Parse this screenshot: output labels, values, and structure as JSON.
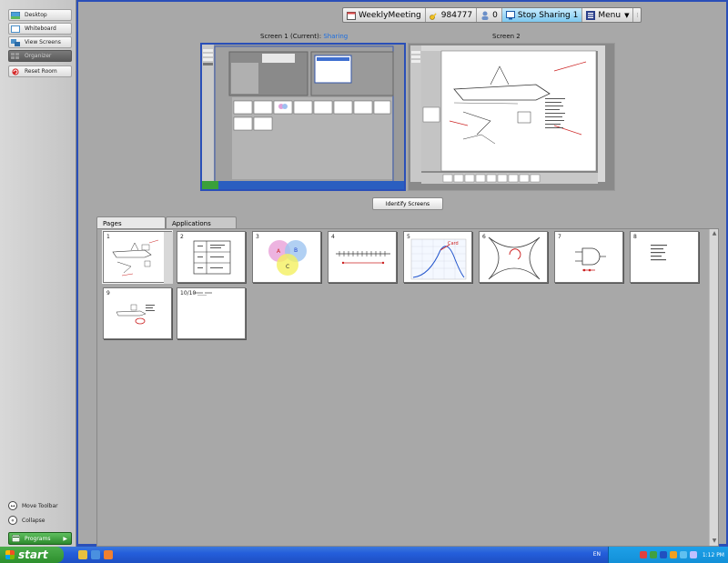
{
  "left_toolbar": {
    "items": [
      {
        "label": "Desktop",
        "active": false
      },
      {
        "label": "Whiteboard",
        "active": false
      },
      {
        "label": "View Screens",
        "active": false
      },
      {
        "label": "Organizer",
        "active": true
      },
      {
        "label": "Reset Room",
        "active": false
      }
    ],
    "move_label": "Move Toolbar",
    "collapse_label": "Collapse",
    "programs_label": "Programs"
  },
  "top_toolbar": {
    "meeting_name": "WeeklyMeeting",
    "meeting_id": "984777",
    "participant_count": "0",
    "share_label": "Stop Sharing 1",
    "menu_label": "Menu"
  },
  "screens": {
    "screen1_label": "Screen 1 (Current):",
    "screen1_status": "Sharing",
    "screen2_label": "Screen 2",
    "identify_label": "Identify Screens"
  },
  "tabs": {
    "pages": "Pages",
    "applications": "Applications"
  },
  "pages": [
    {
      "num": "1"
    },
    {
      "num": "2"
    },
    {
      "num": "3"
    },
    {
      "num": "4"
    },
    {
      "num": "5"
    },
    {
      "num": "6"
    },
    {
      "num": "7"
    },
    {
      "num": "8"
    },
    {
      "num": "9"
    },
    {
      "num": "10/10"
    }
  ],
  "taskbar": {
    "start_label": "start",
    "lang": "EN",
    "clock": "1:12 PM"
  }
}
